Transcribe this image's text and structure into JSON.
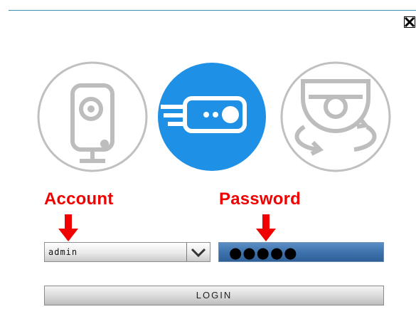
{
  "dialog": {
    "close_icon": "close-x-icon"
  },
  "devices": [
    {
      "icon": "ip-camera-icon",
      "selected": false
    },
    {
      "icon": "nvr-recorder-icon",
      "selected": true
    },
    {
      "icon": "dome-camera-rotate-icon",
      "selected": false
    }
  ],
  "annotations": {
    "account": "Account",
    "password": "Password"
  },
  "account_select": {
    "value": "admin",
    "icon": "chevron-down-icon"
  },
  "password_field": {
    "masked_value": "●●●●●"
  },
  "login_button": {
    "label": "LOGIN"
  },
  "colors": {
    "accent": "#1e90e6",
    "annotation_red": "#f00000",
    "icon_gray": "#bdbdbd",
    "password_bg": "#3f73ad"
  }
}
